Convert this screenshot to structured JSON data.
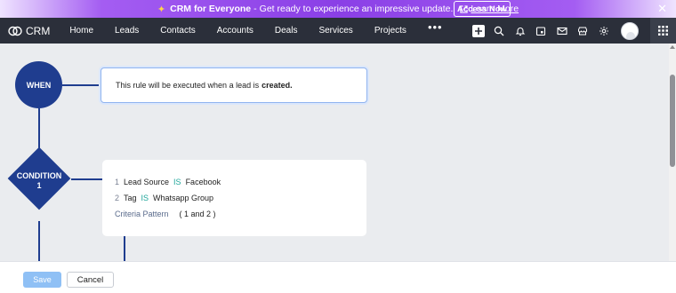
{
  "promo": {
    "sparkle_icon": "sparkle-icon",
    "title": "CRM for Everyone",
    "separator": "-",
    "message": "Get ready to experience an impressive update.",
    "learn_more": "Learn More",
    "access_button": "Access Now",
    "close_icon": "close-icon"
  },
  "nav": {
    "brand": "CRM",
    "items": [
      "Home",
      "Leads",
      "Contacts",
      "Accounts",
      "Deals",
      "Services",
      "Projects"
    ],
    "more": "•••",
    "icons": [
      "plus-icon",
      "search-icon",
      "bell-icon",
      "calendar-icon",
      "mail-icon",
      "marketplace-icon",
      "gear-icon"
    ]
  },
  "flow": {
    "when_label": "WHEN",
    "when_text": "This rule will be executed when a lead is",
    "when_text_bold": "created.",
    "condition_label_line1": "CONDITION",
    "condition_label_line2": "1",
    "criteria": [
      {
        "num": "1",
        "field": "Lead Source",
        "op": "IS",
        "value": "Facebook"
      },
      {
        "num": "2",
        "field": "Tag",
        "op": "IS",
        "value": "Whatsapp Group"
      }
    ],
    "pattern_label": "Criteria Pattern",
    "pattern_value": "( 1 and 2 )"
  },
  "footer": {
    "save": "Save",
    "cancel": "Cancel"
  },
  "colors": {
    "node": "#1f3d8f",
    "nav_bg": "#2b2f3a",
    "promo_purple": "#8a3fe6",
    "operator": "#1fa69a",
    "save_disabled": "#8fc0f5"
  }
}
